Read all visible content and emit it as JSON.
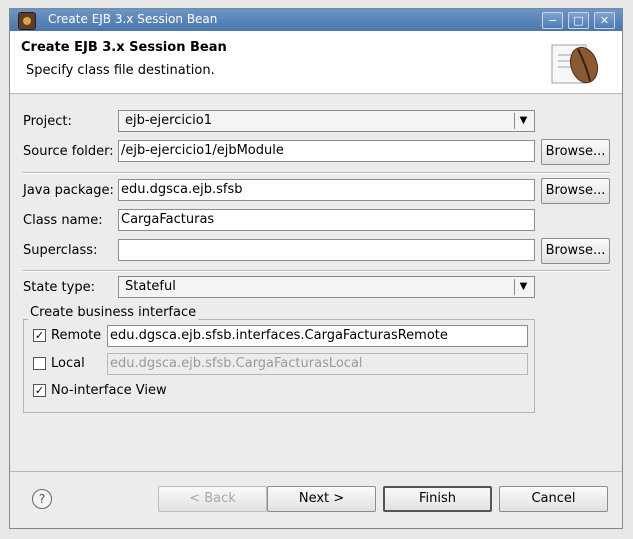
{
  "window": {
    "title": "Create EJB 3.x Session Bean"
  },
  "controls": {
    "minimize": "−",
    "maximize": "□",
    "close": "✕"
  },
  "header": {
    "title": "Create EJB 3.x Session Bean",
    "subtitle": "Specify class file destination."
  },
  "form": {
    "project_label": "Project:",
    "project_value": "ejb-ejercicio1",
    "source_folder_label": "Source folder:",
    "source_folder_value": "/ejb-ejercicio1/ejbModule",
    "java_package_label": "Java package:",
    "java_package_value": "edu.dgsca.ejb.sfsb",
    "class_name_label": "Class name:",
    "class_name_value": "CargaFacturas",
    "superclass_label": "Superclass:",
    "superclass_value": "",
    "browse_label": "Browse...",
    "state_type_label": "State type:",
    "state_type_value": "Stateful"
  },
  "business_interface": {
    "group_title": "Create business interface",
    "remote_label": "Remote",
    "remote_checked": true,
    "remote_value": "edu.dgsca.ejb.sfsb.interfaces.CargaFacturasRemote",
    "local_label": "Local",
    "local_checked": false,
    "local_value": "edu.dgsca.ejb.sfsb.CargaFacturasLocal",
    "no_interface_label": "No-interface View",
    "no_interface_checked": true
  },
  "buttons": {
    "help": "?",
    "back": "< Back",
    "next": "Next >",
    "finish": "Finish",
    "cancel": "Cancel"
  },
  "glyphs": {
    "dropdown": "▼",
    "check": "✓"
  }
}
